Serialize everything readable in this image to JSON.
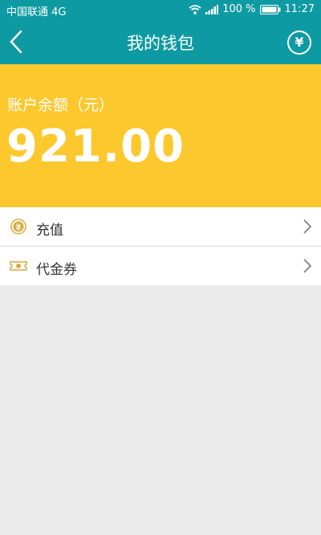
{
  "status_bar": {
    "carrier": "中国联通 4G",
    "battery": "100 %",
    "time": "11:27"
  },
  "header": {
    "title": "我的钱包",
    "right_icon": "yen-icon",
    "right_symbol": "¥"
  },
  "balance": {
    "label": "账户余额（元）",
    "amount": "921.00"
  },
  "menu": {
    "items": [
      {
        "label": "充值",
        "icon": "coin-icon"
      },
      {
        "label": "代金券",
        "icon": "voucher-icon"
      }
    ]
  },
  "colors": {
    "header": "#0e9aa2",
    "balance_bg": "#fdc82e",
    "icon_gold": "#d9aa3e",
    "page_bg": "#ebebeb"
  }
}
